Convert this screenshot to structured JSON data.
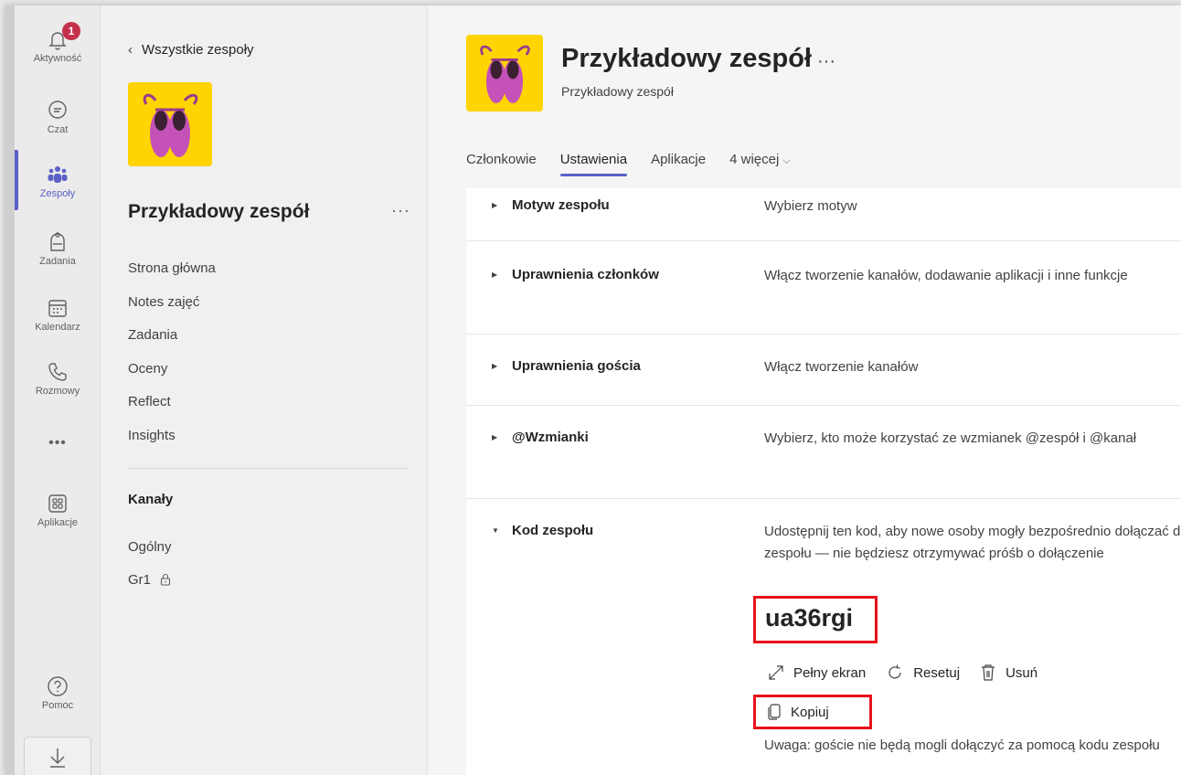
{
  "rail": {
    "items": [
      {
        "label": "Aktywność",
        "icon": "bell-icon",
        "badge": "1"
      },
      {
        "label": "Czat",
        "icon": "chat-icon"
      },
      {
        "label": "Zespoły",
        "icon": "teams-icon"
      },
      {
        "label": "Zadania",
        "icon": "assignments-icon"
      },
      {
        "label": "Kalendarz",
        "icon": "calendar-icon"
      },
      {
        "label": "Rozmowy",
        "icon": "phone-icon"
      },
      {
        "label": "•••",
        "icon": "more-icon"
      },
      {
        "label": "Aplikacje",
        "icon": "apps-icon"
      },
      {
        "label": "Pomoc",
        "icon": "help-icon"
      }
    ],
    "accent": "#5b5fc7"
  },
  "team_panel": {
    "back_label": "Wszystkie zespoły",
    "team_name": "Przykładowy zespół",
    "more": "···",
    "nav": [
      "Strona główna",
      "Notes zajęć",
      "Zadania",
      "Oceny",
      "Reflect",
      "Insights"
    ],
    "channels_title": "Kanały",
    "channels": [
      {
        "name": "Ogólny",
        "locked": false
      },
      {
        "name": "Gr1",
        "locked": true
      }
    ]
  },
  "main": {
    "title": "Przykładowy zespół",
    "title_more": "···",
    "subtitle": "Przykładowy zespół",
    "tabs": [
      "Członkowie",
      "Ustawienia",
      "Aplikacje"
    ],
    "active_tab": "Ustawienia",
    "tab_more": "4 więcej",
    "settings": [
      {
        "name": "Motyw zespołu",
        "desc": "Wybierz motyw",
        "expanded": false
      },
      {
        "name": "Uprawnienia członków",
        "desc": "Włącz tworzenie kanałów, dodawanie aplikacji i inne funkcje",
        "expanded": false
      },
      {
        "name": "Uprawnienia gościa",
        "desc": "Włącz tworzenie kanałów",
        "expanded": false
      },
      {
        "name": "@Wzmianki",
        "desc": "Wybierz, kto może korzystać ze wzmianek @zespół i @kanał",
        "expanded": false
      },
      {
        "name": "Kod zespołu",
        "desc": "Udostępnij ten kod, aby nowe osoby mogły bezpośrednio dołączać do zespołu — nie będziesz otrzymywać próśb o dołączenie",
        "expanded": true
      }
    ],
    "team_code": "ua36rgi",
    "code_actions": {
      "fullscreen": "Pełny ekran",
      "reset": "Resetuj",
      "delete": "Usuń",
      "copy": "Kopiuj"
    },
    "note": "Uwaga: goście nie będą mogli dołączyć za pomocą kodu zespołu",
    "highlight_color": "#e8121b"
  }
}
